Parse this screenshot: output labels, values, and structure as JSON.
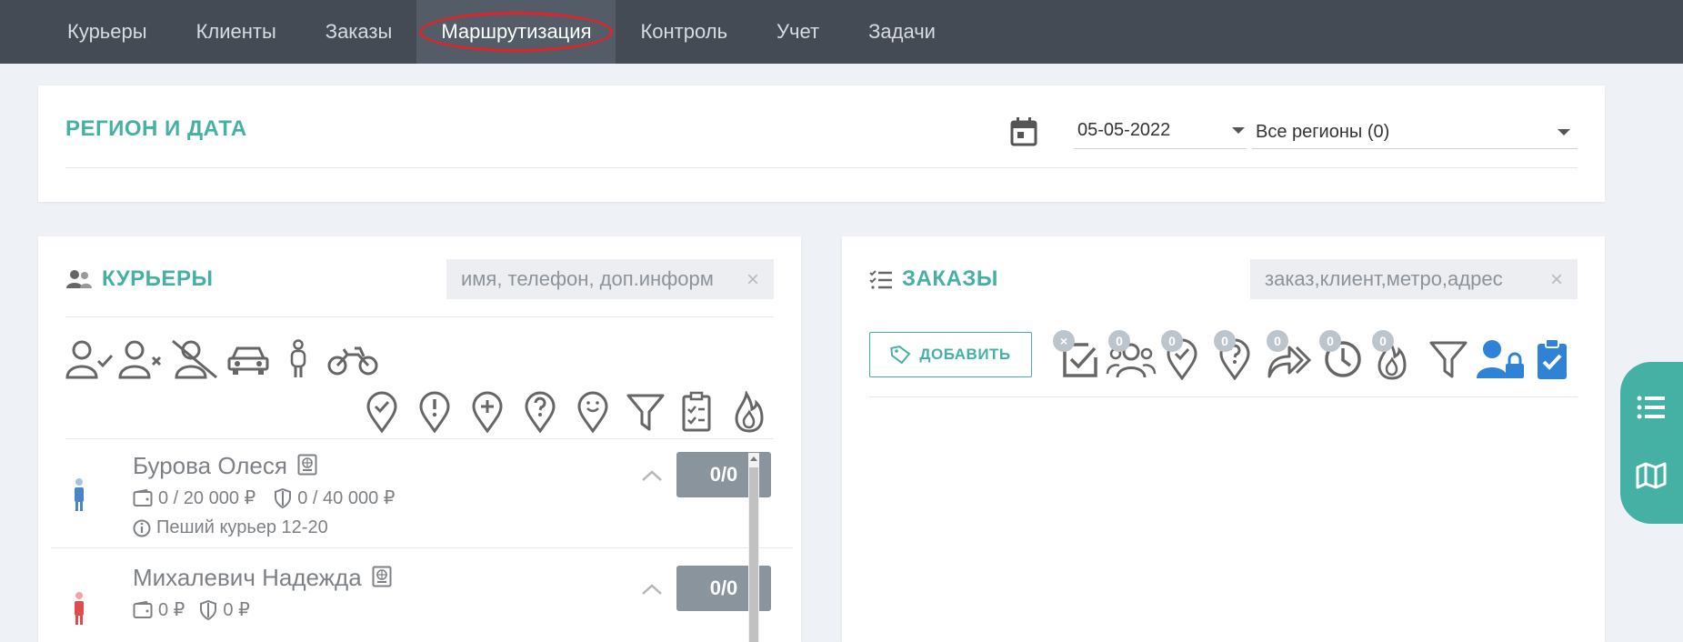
{
  "nav": {
    "items": [
      "Курьеры",
      "Клиенты",
      "Заказы",
      "Маршрутизация",
      "Контроль",
      "Учет",
      "Задачи"
    ],
    "active_index": 3
  },
  "region": {
    "title": "РЕГИОН И ДАТА",
    "date": "05-05-2022",
    "region_select": "Все регионы (0)"
  },
  "couriers": {
    "title": "КУРЬЕРЫ",
    "search_placeholder": "имя, телефон, доп.информ",
    "list": [
      {
        "name": "Бурова Олеся",
        "wallet": "0 / 20 000 ₽",
        "shield": "0 / 40 000 ₽",
        "info": "Пеший курьер 12-20",
        "counter": "0/0",
        "marker_color": "#4a86c5"
      },
      {
        "name": "Михалевич Надежда",
        "wallet": "0 ₽",
        "shield": "0 ₽",
        "info": "",
        "counter": "0/0",
        "marker_color": "#e24b4b"
      }
    ]
  },
  "orders": {
    "title": "ЗАКАЗЫ",
    "search_placeholder": "заказ,клиент,метро,адрес",
    "add_label": "ДОБАВИТЬ",
    "badges": [
      "×",
      "0",
      "0",
      "0",
      "0",
      "0",
      "0"
    ]
  },
  "colors": {
    "accent": "#45b0a4",
    "nav_bg": "#444b55",
    "highlight_ring": "#e0242b",
    "blue_icon": "#2e83d6"
  }
}
